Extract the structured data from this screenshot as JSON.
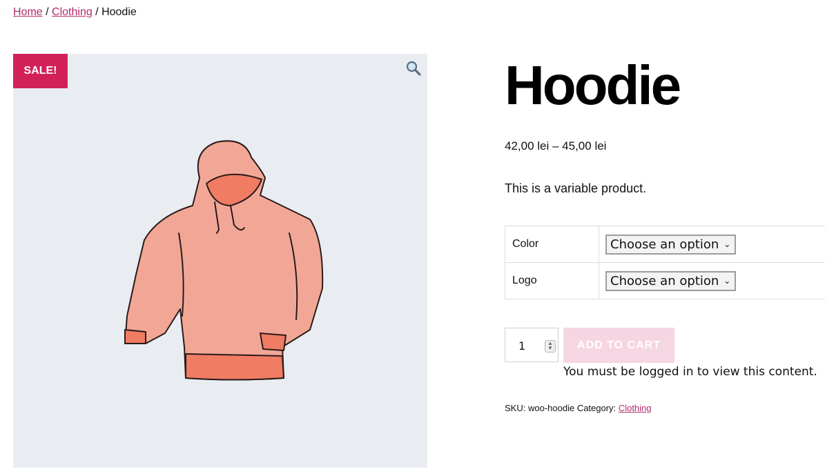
{
  "breadcrumb": {
    "home": "Home",
    "sep1": " / ",
    "category": "Clothing",
    "sep2": " / ",
    "current": "Hoodie"
  },
  "gallery": {
    "badge": "SALE!",
    "zoom_icon": "magnifier-icon",
    "image_alt": "Hoodie"
  },
  "product": {
    "title": "Hoodie",
    "price": "42,00 lei – 45,00 lei",
    "description": "This is a variable product.",
    "variations": [
      {
        "label": "Color",
        "selected": "Choose an option"
      },
      {
        "label": "Logo",
        "selected": "Choose an option"
      }
    ],
    "quantity": "1",
    "add_to_cart": "ADD TO CART",
    "login_message": "You must be logged in to view this content.",
    "meta": {
      "sku_label": "SKU:",
      "sku": "woo-hoodie",
      "category_label": "Category:",
      "category": "Clothing"
    }
  },
  "colors": {
    "accent": "#b02a6a",
    "sale_badge": "#d2215a",
    "button_disabled": "#f6d6e2",
    "gallery_bg": "#e9edf2"
  }
}
